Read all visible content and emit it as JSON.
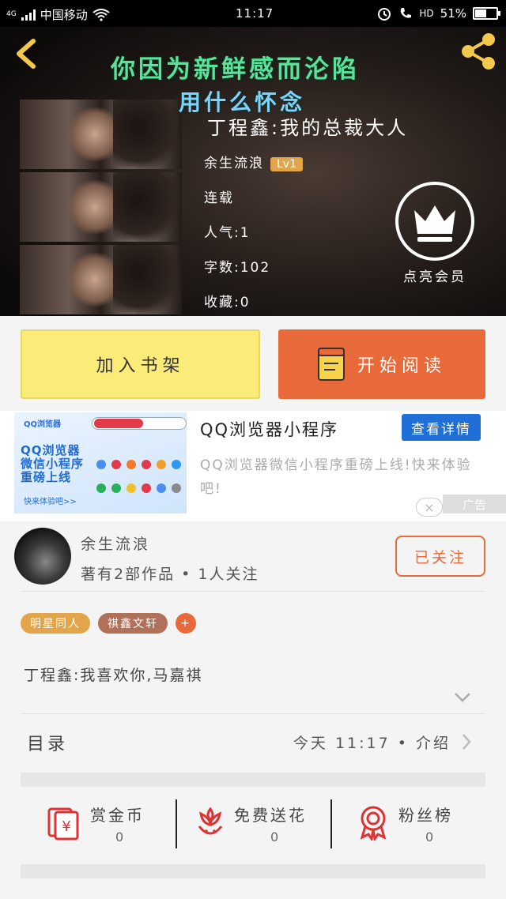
{
  "status_bar": {
    "network": "4G",
    "carrier": "中国移动",
    "time": "11:17",
    "hd": "HD",
    "battery": "51%",
    "battery_level": 0.51
  },
  "hero": {
    "overlay_line1": "你因为新鲜感而沦陷",
    "overlay_line2": "用什么怀念",
    "book_title": "丁程鑫:我的总裁大人",
    "author": "余生流浪",
    "level": "Lv1",
    "status": "连载",
    "popularity": "人气:1",
    "word_count": "字数:102",
    "favorites": "收藏:0",
    "vip_label": "点亮会员"
  },
  "actions": {
    "add_shelf": "加入书架",
    "start_reading": "开始阅读"
  },
  "ad": {
    "image_brand": "QQ浏览器",
    "image_headline": "QQ浏览器\n微信小程序\n重磅上线",
    "image_cta": "快来体验吧>>",
    "title": "QQ浏览器小程序",
    "detail_button": "查看详情",
    "description": "QQ浏览器微信小程序重磅上线!快来体验吧!",
    "close": "×",
    "tag": "广告"
  },
  "author_card": {
    "name": "余生流浪",
    "meta": "著有2部作品 • 1人关注",
    "follow_button": "已关注"
  },
  "tags": [
    "明星同人",
    "祺鑫文轩",
    "+"
  ],
  "description": "丁程鑫:我喜欢你,马嘉祺",
  "toc": {
    "title": "目录",
    "update": "今天 11:17 • 介绍"
  },
  "stats": [
    {
      "label": "赏金币",
      "value": "0",
      "icon": "red-envelope-icon"
    },
    {
      "label": "免费送花",
      "value": "0",
      "icon": "flower-icon"
    },
    {
      "label": "粉丝榜",
      "value": "0",
      "icon": "medal-icon"
    }
  ],
  "colors": {
    "accent": "#e86a3a",
    "shelf_button": "#fbec79",
    "tag_orange": "#e3a54a",
    "tag_brown": "#b0705a",
    "ad_blue": "#1f6fd6",
    "overlay_green": "#59e39a",
    "overlay_blue": "#7ad6f4"
  }
}
